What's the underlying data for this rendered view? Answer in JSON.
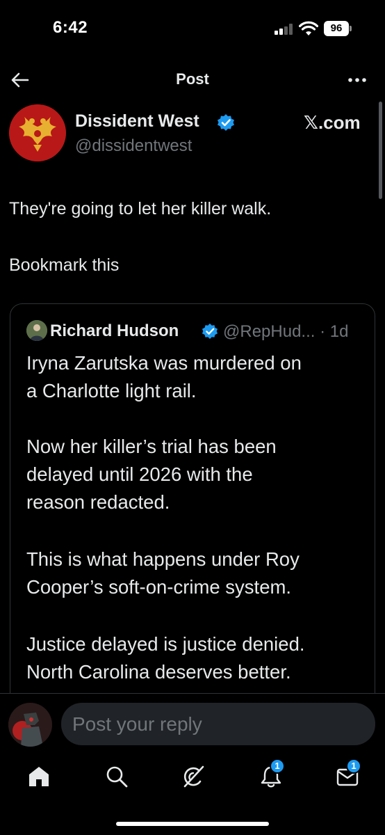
{
  "status_bar": {
    "time": "6:42",
    "battery": "96"
  },
  "header": {
    "title": "Post"
  },
  "post": {
    "author_name": "Dissident West",
    "author_handle": "@dissidentwest",
    "source": "𝕏.com",
    "text_lines": [
      "They're going to let her killer walk.",
      "Bookmark this"
    ]
  },
  "quote": {
    "author_name": "Richard Hudson",
    "meta": "@RepHud... · 1d",
    "paragraphs": [
      [
        "Iryna Zarutska was murdered on",
        "a Charlotte light rail."
      ],
      [
        "Now her killer’s trial has been",
        "delayed until 2026 with the",
        "reason redacted."
      ],
      [
        "This is what happens under Roy",
        "Cooper’s soft-on-crime system."
      ],
      [
        "Justice delayed is justice denied.",
        "North Carolina deserves better."
      ]
    ]
  },
  "reply": {
    "placeholder": "Post your reply"
  },
  "tabs": {
    "notifications_badge": "1",
    "messages_badge": "1"
  },
  "colors": {
    "accent": "#1d9bf0",
    "background": "#000000",
    "text": "#e7e9ea",
    "muted": "#71767b",
    "border": "#2f3336"
  }
}
